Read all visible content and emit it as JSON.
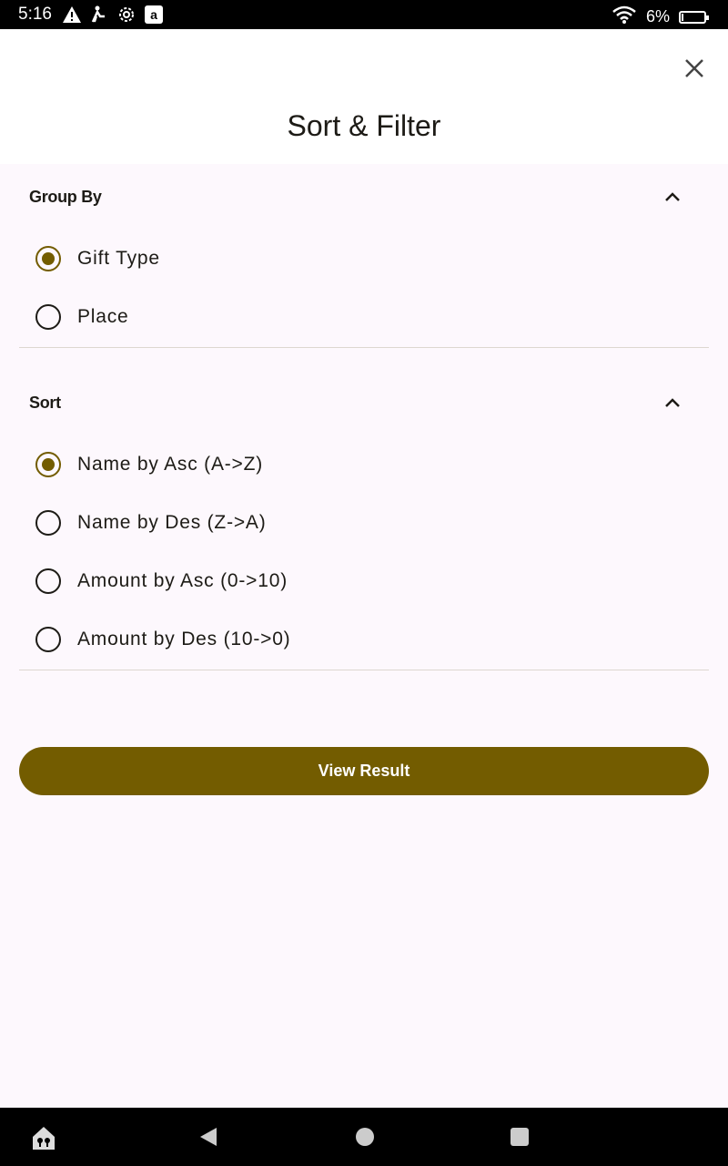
{
  "status_bar": {
    "time": "5:16",
    "battery_text": "6%",
    "battery_level": 0.06
  },
  "header": {
    "title": "Sort & Filter"
  },
  "group_by": {
    "title": "Group By",
    "options": [
      {
        "label": "Gift Type",
        "checked": true
      },
      {
        "label": "Place",
        "checked": false
      }
    ]
  },
  "sort": {
    "title": "Sort",
    "options": [
      {
        "label": "Name by Asc (A->Z)",
        "checked": true
      },
      {
        "label": "Name by Des (Z->A)",
        "checked": false
      },
      {
        "label": "Amount by Asc (0->10)",
        "checked": false
      },
      {
        "label": "Amount by Des (10->0)",
        "checked": false
      }
    ]
  },
  "actions": {
    "view_result": "View Result"
  },
  "colors": {
    "accent": "#735c00",
    "background": "#fdf8fd"
  }
}
